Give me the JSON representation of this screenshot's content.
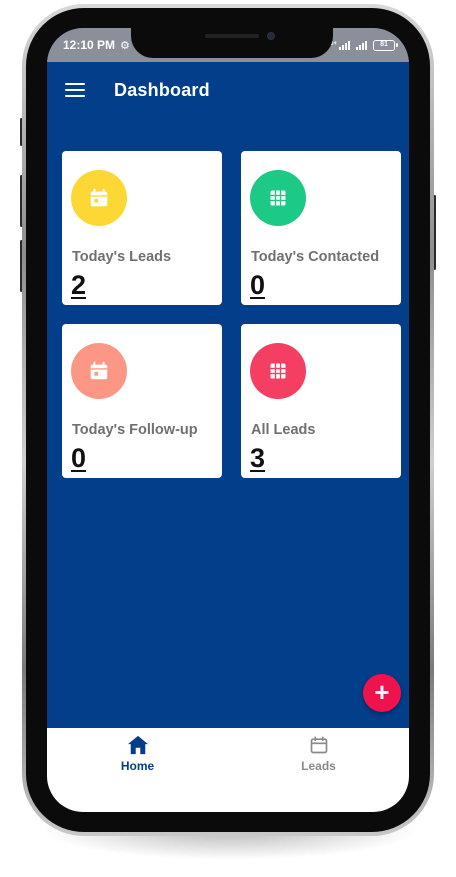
{
  "status_bar": {
    "time": "12:10 PM",
    "network_label": "4G+",
    "battery": "81"
  },
  "app_bar": {
    "title": "Dashboard"
  },
  "cards": [
    {
      "label": "Today's Leads",
      "count": "2",
      "icon": "calendar-icon",
      "color": "#fdd835"
    },
    {
      "label": "Today's Contacted",
      "count": "0",
      "icon": "grid-icon",
      "color": "#1cc985"
    },
    {
      "label": "Today's Follow-up",
      "count": "0",
      "icon": "calendar-icon",
      "color": "#fb9784"
    },
    {
      "label": "All Leads",
      "count": "3",
      "icon": "grid-icon",
      "color": "#f43f63"
    }
  ],
  "fab": {
    "icon": "plus-icon",
    "color": "#f0124d"
  },
  "bottom_nav": {
    "items": [
      {
        "label": "Home",
        "icon": "home-icon",
        "active": true
      },
      {
        "label": "Leads",
        "icon": "calendar-icon",
        "active": false
      }
    ]
  },
  "colors": {
    "primary": "#023e8a",
    "card_bg": "#ffffff"
  }
}
